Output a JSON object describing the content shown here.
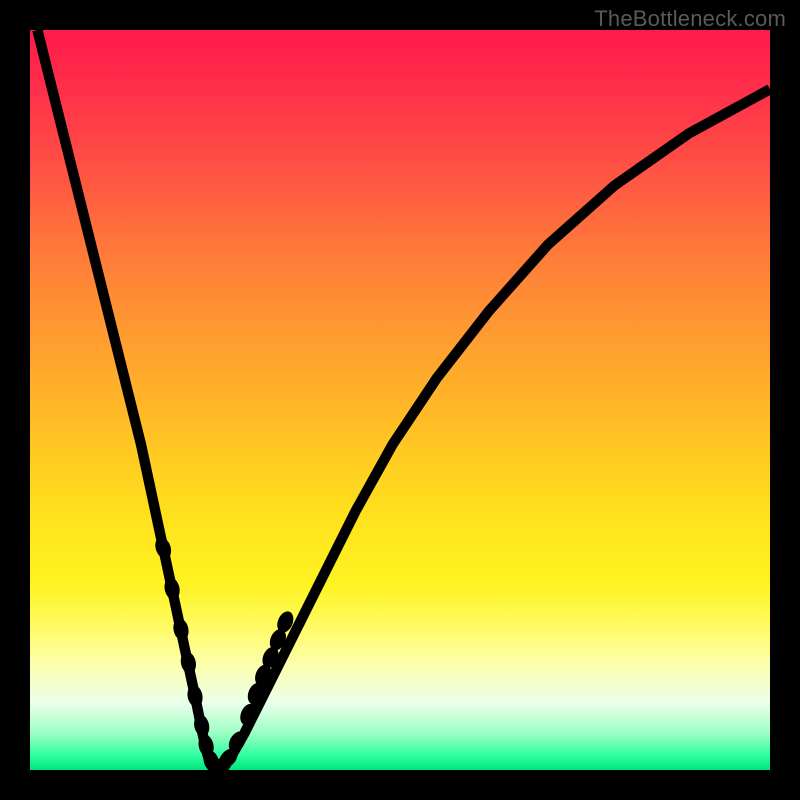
{
  "watermark": "TheBottleneck.com",
  "chart_data": {
    "type": "line",
    "title": "",
    "xlabel": "",
    "ylabel": "",
    "xlim": [
      0,
      100
    ],
    "ylim": [
      0,
      100
    ],
    "series": [
      {
        "name": "left-branch",
        "x": [
          1,
          3,
          5,
          7,
          9,
          11,
          13,
          15,
          16.5,
          18,
          19.5,
          21,
          22.3,
          23.3,
          24,
          24.6,
          25.1
        ],
        "y": [
          100,
          92,
          84,
          76,
          68,
          60,
          52,
          44,
          37,
          30,
          23,
          16,
          10,
          5,
          2,
          0.6,
          0.1
        ]
      },
      {
        "name": "right-branch",
        "x": [
          25.1,
          26,
          27.3,
          29,
          31,
          33.5,
          36.5,
          40,
          44,
          49,
          55,
          62,
          70,
          79,
          89,
          100
        ],
        "y": [
          0.1,
          0.6,
          2,
          5,
          9,
          14,
          20,
          27,
          35,
          44,
          53,
          62,
          71,
          79,
          86,
          92
        ]
      }
    ],
    "markers": {
      "name": "highlighted-points",
      "x": [
        18.0,
        19.2,
        20.4,
        21.4,
        22.3,
        23.2,
        23.8,
        24.5,
        25.1,
        25.9,
        26.8,
        28.0,
        29.5,
        30.5,
        31.5,
        32.5,
        33.5,
        34.5
      ],
      "y": [
        30.0,
        24.5,
        19.0,
        14.5,
        10.0,
        6.0,
        3.3,
        1.2,
        0.1,
        0.6,
        1.6,
        3.8,
        7.5,
        10.3,
        12.8,
        15.2,
        17.6,
        20.0
      ]
    },
    "gradient_stops": [
      {
        "pos": 0,
        "color": "#ff1a4a"
      },
      {
        "pos": 18,
        "color": "#ff4f44"
      },
      {
        "pos": 42,
        "color": "#ff9e30"
      },
      {
        "pos": 66,
        "color": "#ffe21c"
      },
      {
        "pos": 86,
        "color": "#fcffb0"
      },
      {
        "pos": 100,
        "color": "#00e67a"
      }
    ]
  }
}
